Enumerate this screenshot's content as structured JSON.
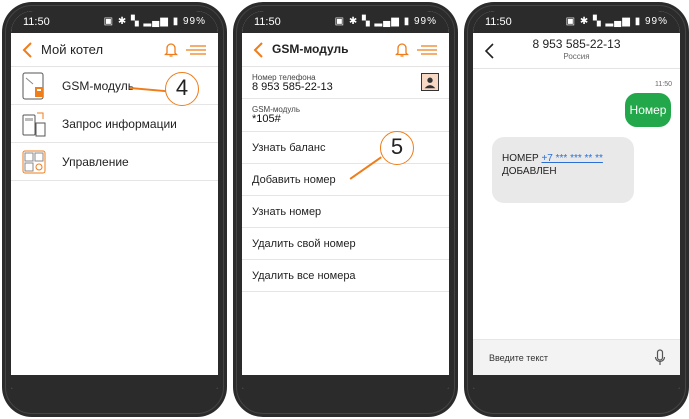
{
  "colors": {
    "accent": "#ee7d1a",
    "frame": "#2b2b2b",
    "bubble_out": "#22a84a",
    "link": "#2a6fd6"
  },
  "status": {
    "time": "11:50",
    "icons": "▣ ✱ ▚ ▂▄▆ ▮",
    "battery": "99%"
  },
  "phone1": {
    "title": "Мой котел",
    "items": [
      {
        "label": "GSM-модуль",
        "icon": "gsm-module-icon"
      },
      {
        "label": "Запрос информации",
        "icon": "info-request-icon"
      },
      {
        "label": "Управление",
        "icon": "control-icon"
      }
    ],
    "callout": "4"
  },
  "phone2": {
    "title": "GSM-модуль",
    "phone_caption": "Номер телефона",
    "phone_value": "8 953 585-22-13",
    "gsm_caption": "GSM-модуль",
    "gsm_value": "*105#",
    "items": [
      "Узнать баланс",
      "Добавить номер",
      "Узнать номер",
      "Удалить свой номер",
      "Удалить все номера"
    ],
    "callout": "5"
  },
  "phone3": {
    "contact": "8 953 585-22-13",
    "country": "Россия",
    "time": "11:50",
    "outgoing": "Номер",
    "incoming_prefix": "НОМЕР",
    "incoming_link": "+7 *** *** ** **",
    "incoming_suffix": "ДОБАВЛЕН",
    "input_placeholder": "Введите текст"
  }
}
